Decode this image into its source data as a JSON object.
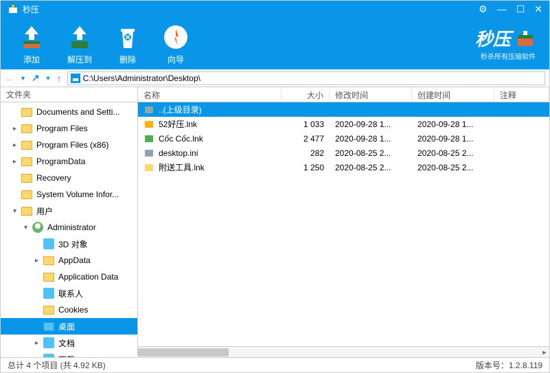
{
  "app": {
    "title": "秒压"
  },
  "window_controls": {
    "settings": "⚙",
    "min": "—",
    "max": "☐",
    "close": "✕"
  },
  "toolbar": {
    "add": "添加",
    "extract_to": "解压到",
    "delete": "删除",
    "wizard": "向导"
  },
  "brand": {
    "title": "秒压",
    "sub": "秒杀所有压缩软件"
  },
  "nav": {
    "path": "C:\\Users\\Administrator\\Desktop\\"
  },
  "sidebar": {
    "header": "文件夹",
    "items": [
      {
        "label": "Documents and Setti...",
        "depth": 1,
        "expander": "",
        "sel": false
      },
      {
        "label": "Program Files",
        "depth": 1,
        "expander": "▸",
        "sel": false
      },
      {
        "label": "Program Files (x86)",
        "depth": 1,
        "expander": "▸",
        "sel": false
      },
      {
        "label": "ProgramData",
        "depth": 1,
        "expander": "▸",
        "sel": false
      },
      {
        "label": "Recovery",
        "depth": 1,
        "expander": "",
        "sel": false
      },
      {
        "label": "System Volume Infor...",
        "depth": 1,
        "expander": "",
        "sel": false
      },
      {
        "label": "用户",
        "depth": 1,
        "expander": "▾",
        "sel": false
      },
      {
        "label": "Administrator",
        "depth": 2,
        "expander": "▾",
        "sel": false,
        "user": true
      },
      {
        "label": "3D 对象",
        "depth": 3,
        "expander": "",
        "sel": false,
        "special": true
      },
      {
        "label": "AppData",
        "depth": 3,
        "expander": "▸",
        "sel": false
      },
      {
        "label": "Application Data",
        "depth": 3,
        "expander": "",
        "sel": false
      },
      {
        "label": "联系人",
        "depth": 3,
        "expander": "",
        "sel": false,
        "special": true
      },
      {
        "label": "Cookies",
        "depth": 3,
        "expander": "",
        "sel": false
      },
      {
        "label": "桌面",
        "depth": 3,
        "expander": "",
        "sel": true,
        "blue": true
      },
      {
        "label": "文档",
        "depth": 3,
        "expander": "▸",
        "sel": false,
        "special": true
      },
      {
        "label": "下载",
        "depth": 3,
        "expander": "▸",
        "sel": false,
        "special": true
      }
    ]
  },
  "columns": {
    "name": "名称",
    "size": "大小",
    "mtime": "修改时间",
    "ctime": "创建时间",
    "comment": "注释"
  },
  "files": [
    {
      "name": "..(上级目录)",
      "size": "",
      "mtime": "",
      "ctime": "",
      "comment": "",
      "sel": true,
      "iconColor": "#8aa"
    },
    {
      "name": "52好压.lnk",
      "size": "1 033",
      "mtime": "2020-09-28 1...",
      "ctime": "2020-09-28 1...",
      "comment": "",
      "sel": false,
      "iconColor": "#ffb300"
    },
    {
      "name": "Cốc Cốc.lnk",
      "size": "2 477",
      "mtime": "2020-09-28 1...",
      "ctime": "2020-09-28 1...",
      "comment": "",
      "sel": false,
      "iconColor": "#4caf50"
    },
    {
      "name": "desktop.ini",
      "size": "282",
      "mtime": "2020-08-25 2...",
      "ctime": "2020-08-25 2...",
      "comment": "",
      "sel": false,
      "iconColor": "#90a4ae"
    },
    {
      "name": "附送工具.lnk",
      "size": "1 250",
      "mtime": "2020-08-25 2...",
      "ctime": "2020-08-25 2...",
      "comment": "",
      "sel": false,
      "iconColor": "#ffd76a"
    }
  ],
  "status": {
    "left": "总计 4 个项目 (共 4.92 KB)",
    "right": "版本号：1.2.8.119"
  }
}
